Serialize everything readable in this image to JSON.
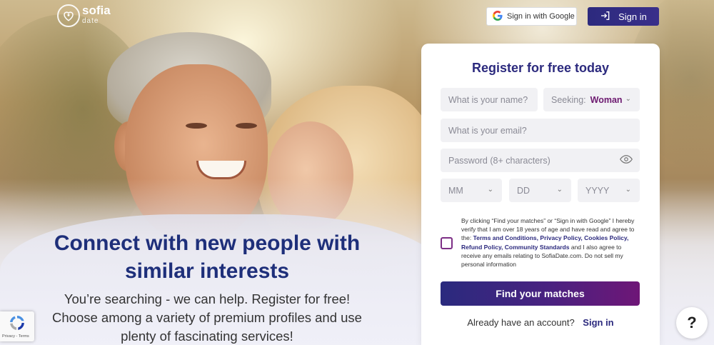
{
  "brand": {
    "name": "sofia",
    "sub": "date"
  },
  "header": {
    "google_signin_label": "Sign in with Google",
    "signin_label": "Sign in"
  },
  "hero": {
    "title_line1": "Connect with new people with",
    "title_line2": "similar interests",
    "sub_line1": "You’re searching - we can help. Register for free!",
    "sub_line2": "Choose among a variety of premium profiles and use",
    "sub_line3": "plenty of fascinating services!"
  },
  "form": {
    "title": "Register for free today",
    "name_placeholder": "What is your name?",
    "seeking_label": "Seeking:",
    "seeking_value": "Woman",
    "email_placeholder": "What is your email?",
    "password_placeholder": "Password (8+ characters)",
    "month_placeholder": "MM",
    "day_placeholder": "DD",
    "year_placeholder": "YYYY",
    "consent": {
      "text1": "By clicking “Find your matches” or “Sign in with Google” I hereby verify that I am over 18 years of age and have read and agree to the:",
      "terms": "Terms and Conditions,",
      "privacy": "Privacy Policy,",
      "cookies": "Cookies Policy,",
      "refund": "Refund Policy,",
      "community": "Community Standards",
      "text2": "and I also agree to receive any emails relating to SofiaDate.com. Do not sell my personal information"
    },
    "submit_label": "Find your matches",
    "already_text": "Already have an account?",
    "signin_link": "Sign in"
  },
  "recaptcha": {
    "links": "Privacy - Terms"
  },
  "help": {
    "label": "?"
  },
  "colors": {
    "primary": "#2c2a7e",
    "accent": "#6e1677",
    "hero_title": "#1e2f7a"
  },
  "icons": [
    "logo-heart-icon",
    "google-icon",
    "signin-arrow-icon",
    "chevron-down-icon",
    "eye-icon",
    "recaptcha-icon"
  ]
}
